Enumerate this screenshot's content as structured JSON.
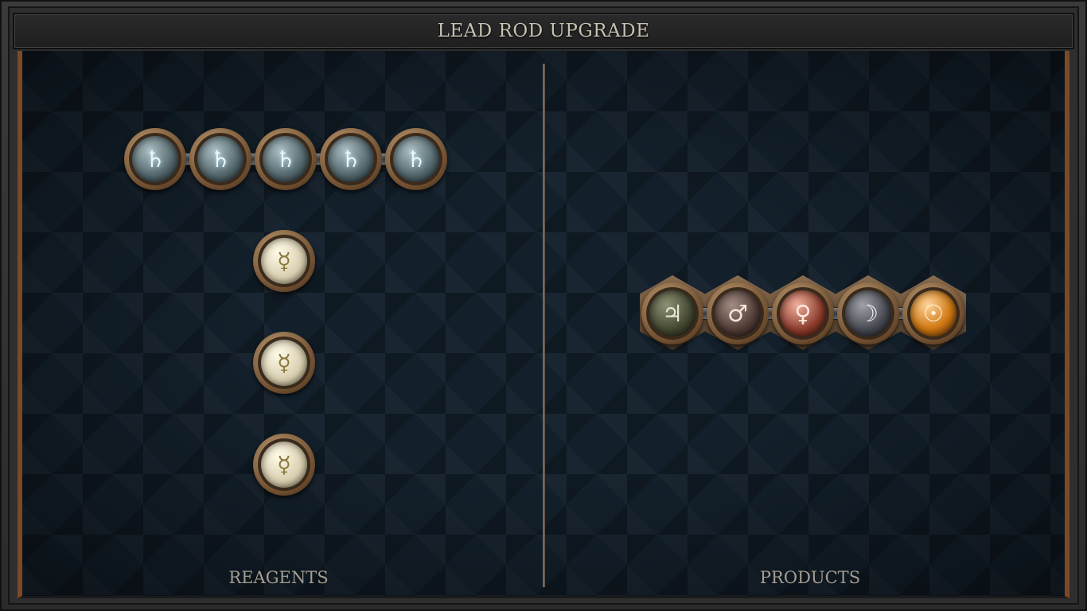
{
  "window": {
    "title": "LEAD ROD UPGRADE"
  },
  "reagents": {
    "label": "REAGENTS",
    "row": [
      {
        "element": "lead",
        "symbol": "♄"
      },
      {
        "element": "lead",
        "symbol": "♄"
      },
      {
        "element": "lead",
        "symbol": "♄"
      },
      {
        "element": "lead",
        "symbol": "♄"
      },
      {
        "element": "lead",
        "symbol": "♄"
      }
    ],
    "column": [
      {
        "element": "quicksilver",
        "symbol": "☿"
      },
      {
        "element": "quicksilver",
        "symbol": "☿"
      },
      {
        "element": "quicksilver",
        "symbol": "☿"
      }
    ]
  },
  "products": {
    "label": "PRODUCTS",
    "row": [
      {
        "element": "tin",
        "symbol": "♃"
      },
      {
        "element": "iron",
        "symbol": "♂"
      },
      {
        "element": "copper",
        "symbol": "♀"
      },
      {
        "element": "silver",
        "symbol": "☽"
      },
      {
        "element": "gold",
        "symbol": "☉"
      }
    ]
  },
  "colors": {
    "background": "#13202b",
    "frame_accent": "#7a4a26",
    "title_text": "#c9c1b2",
    "label_text": "#a39c90"
  }
}
